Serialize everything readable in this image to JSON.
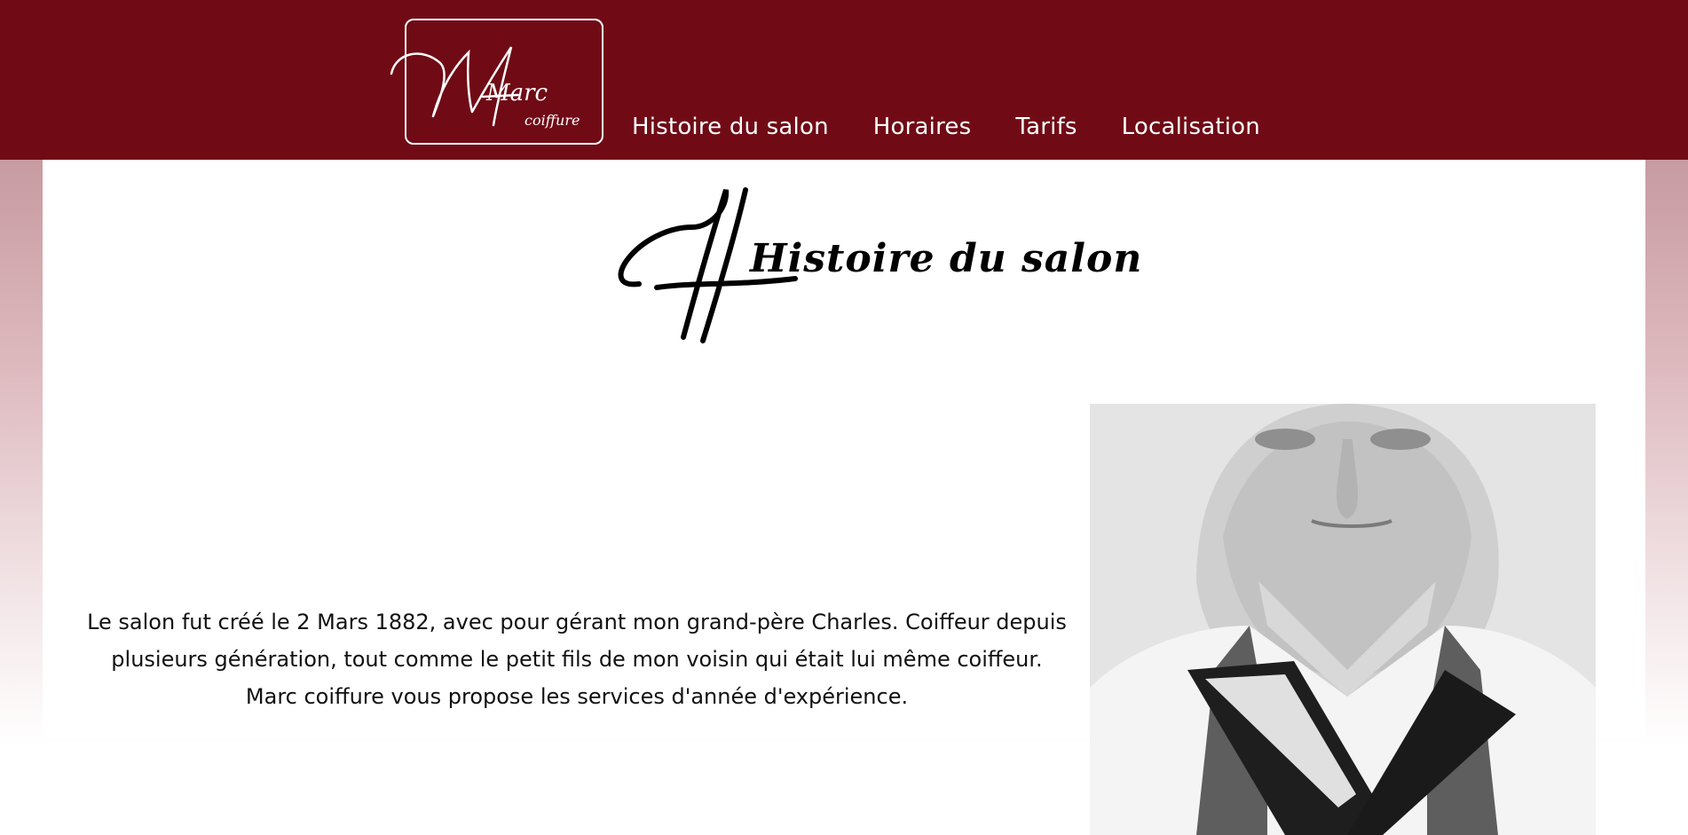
{
  "brand": {
    "logo_main": "Marc",
    "logo_sub": "coiffure"
  },
  "nav": {
    "items": [
      {
        "label": "Histoire du salon"
      },
      {
        "label": "Horaires"
      },
      {
        "label": "Tarifs"
      },
      {
        "label": "Localisation"
      }
    ]
  },
  "main": {
    "title": "Histoire du salon",
    "paragraph_lines": [
      "Le salon fut créé le 2 Mars 1882, avec pour gérant mon grand-père Charles. Coiffeur depuis",
      "plusieurs génération, tout comme le petit fils de mon voisin qui était lui même coiffeur.",
      "Marc coiffure vous propose les services d'année d'expérience."
    ]
  },
  "colors": {
    "header_bg": "#700b16",
    "nav_text": "#ffffff"
  }
}
